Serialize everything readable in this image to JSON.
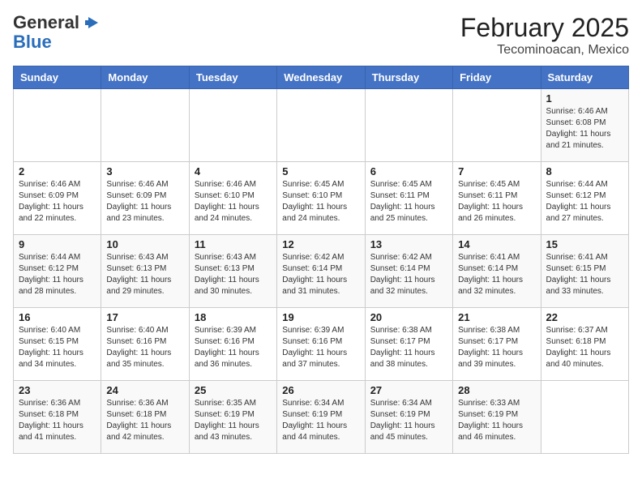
{
  "header": {
    "logo_general": "General",
    "logo_blue": "Blue",
    "month_year": "February 2025",
    "location": "Tecominoacan, Mexico"
  },
  "weekdays": [
    "Sunday",
    "Monday",
    "Tuesday",
    "Wednesday",
    "Thursday",
    "Friday",
    "Saturday"
  ],
  "weeks": [
    [
      {
        "day": "",
        "info": ""
      },
      {
        "day": "",
        "info": ""
      },
      {
        "day": "",
        "info": ""
      },
      {
        "day": "",
        "info": ""
      },
      {
        "day": "",
        "info": ""
      },
      {
        "day": "",
        "info": ""
      },
      {
        "day": "1",
        "info": "Sunrise: 6:46 AM\nSunset: 6:08 PM\nDaylight: 11 hours\nand 21 minutes."
      }
    ],
    [
      {
        "day": "2",
        "info": "Sunrise: 6:46 AM\nSunset: 6:09 PM\nDaylight: 11 hours\nand 22 minutes."
      },
      {
        "day": "3",
        "info": "Sunrise: 6:46 AM\nSunset: 6:09 PM\nDaylight: 11 hours\nand 23 minutes."
      },
      {
        "day": "4",
        "info": "Sunrise: 6:46 AM\nSunset: 6:10 PM\nDaylight: 11 hours\nand 24 minutes."
      },
      {
        "day": "5",
        "info": "Sunrise: 6:45 AM\nSunset: 6:10 PM\nDaylight: 11 hours\nand 24 minutes."
      },
      {
        "day": "6",
        "info": "Sunrise: 6:45 AM\nSunset: 6:11 PM\nDaylight: 11 hours\nand 25 minutes."
      },
      {
        "day": "7",
        "info": "Sunrise: 6:45 AM\nSunset: 6:11 PM\nDaylight: 11 hours\nand 26 minutes."
      },
      {
        "day": "8",
        "info": "Sunrise: 6:44 AM\nSunset: 6:12 PM\nDaylight: 11 hours\nand 27 minutes."
      }
    ],
    [
      {
        "day": "9",
        "info": "Sunrise: 6:44 AM\nSunset: 6:12 PM\nDaylight: 11 hours\nand 28 minutes."
      },
      {
        "day": "10",
        "info": "Sunrise: 6:43 AM\nSunset: 6:13 PM\nDaylight: 11 hours\nand 29 minutes."
      },
      {
        "day": "11",
        "info": "Sunrise: 6:43 AM\nSunset: 6:13 PM\nDaylight: 11 hours\nand 30 minutes."
      },
      {
        "day": "12",
        "info": "Sunrise: 6:42 AM\nSunset: 6:14 PM\nDaylight: 11 hours\nand 31 minutes."
      },
      {
        "day": "13",
        "info": "Sunrise: 6:42 AM\nSunset: 6:14 PM\nDaylight: 11 hours\nand 32 minutes."
      },
      {
        "day": "14",
        "info": "Sunrise: 6:41 AM\nSunset: 6:14 PM\nDaylight: 11 hours\nand 32 minutes."
      },
      {
        "day": "15",
        "info": "Sunrise: 6:41 AM\nSunset: 6:15 PM\nDaylight: 11 hours\nand 33 minutes."
      }
    ],
    [
      {
        "day": "16",
        "info": "Sunrise: 6:40 AM\nSunset: 6:15 PM\nDaylight: 11 hours\nand 34 minutes."
      },
      {
        "day": "17",
        "info": "Sunrise: 6:40 AM\nSunset: 6:16 PM\nDaylight: 11 hours\nand 35 minutes."
      },
      {
        "day": "18",
        "info": "Sunrise: 6:39 AM\nSunset: 6:16 PM\nDaylight: 11 hours\nand 36 minutes."
      },
      {
        "day": "19",
        "info": "Sunrise: 6:39 AM\nSunset: 6:16 PM\nDaylight: 11 hours\nand 37 minutes."
      },
      {
        "day": "20",
        "info": "Sunrise: 6:38 AM\nSunset: 6:17 PM\nDaylight: 11 hours\nand 38 minutes."
      },
      {
        "day": "21",
        "info": "Sunrise: 6:38 AM\nSunset: 6:17 PM\nDaylight: 11 hours\nand 39 minutes."
      },
      {
        "day": "22",
        "info": "Sunrise: 6:37 AM\nSunset: 6:18 PM\nDaylight: 11 hours\nand 40 minutes."
      }
    ],
    [
      {
        "day": "23",
        "info": "Sunrise: 6:36 AM\nSunset: 6:18 PM\nDaylight: 11 hours\nand 41 minutes."
      },
      {
        "day": "24",
        "info": "Sunrise: 6:36 AM\nSunset: 6:18 PM\nDaylight: 11 hours\nand 42 minutes."
      },
      {
        "day": "25",
        "info": "Sunrise: 6:35 AM\nSunset: 6:19 PM\nDaylight: 11 hours\nand 43 minutes."
      },
      {
        "day": "26",
        "info": "Sunrise: 6:34 AM\nSunset: 6:19 PM\nDaylight: 11 hours\nand 44 minutes."
      },
      {
        "day": "27",
        "info": "Sunrise: 6:34 AM\nSunset: 6:19 PM\nDaylight: 11 hours\nand 45 minutes."
      },
      {
        "day": "28",
        "info": "Sunrise: 6:33 AM\nSunset: 6:19 PM\nDaylight: 11 hours\nand 46 minutes."
      },
      {
        "day": "",
        "info": ""
      }
    ]
  ]
}
